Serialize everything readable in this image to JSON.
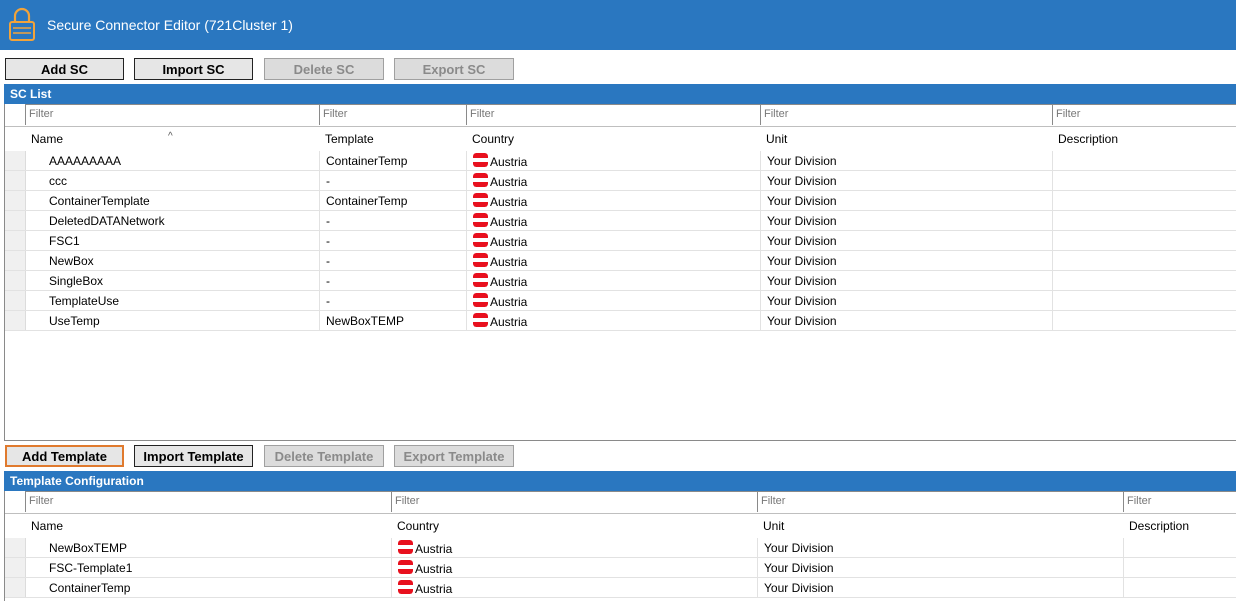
{
  "window": {
    "title": "Secure Connector Editor (721Cluster 1)"
  },
  "sc_toolbar": {
    "add": "Add SC",
    "import": "Import SC",
    "delete": "Delete SC",
    "export": "Export SC"
  },
  "sc_list": {
    "title": "SC List",
    "filter_placeholder": "Filter",
    "columns": [
      "Name",
      "Template",
      "Country",
      "Unit",
      "Description"
    ],
    "rows": [
      {
        "name": "AAAAAAAAA",
        "template": "ContainerTemp",
        "country": "Austria",
        "unit": "Your Division",
        "description": ""
      },
      {
        "name": "ccc",
        "template": "-",
        "country": "Austria",
        "unit": "Your Division",
        "description": ""
      },
      {
        "name": "ContainerTemplate",
        "template": "ContainerTemp",
        "country": "Austria",
        "unit": "Your Division",
        "description": ""
      },
      {
        "name": "DeletedDATANetwork",
        "template": "-",
        "country": "Austria",
        "unit": "Your Division",
        "description": ""
      },
      {
        "name": "FSC1",
        "template": "-",
        "country": "Austria",
        "unit": "Your Division",
        "description": ""
      },
      {
        "name": "NewBox",
        "template": "-",
        "country": "Austria",
        "unit": "Your Division",
        "description": ""
      },
      {
        "name": "SingleBox",
        "template": "-",
        "country": "Austria",
        "unit": "Your Division",
        "description": ""
      },
      {
        "name": "TemplateUse",
        "template": "-",
        "country": "Austria",
        "unit": "Your Division",
        "description": ""
      },
      {
        "name": "UseTemp",
        "template": "NewBoxTEMP",
        "country": "Austria",
        "unit": "Your Division",
        "description": ""
      }
    ]
  },
  "template_toolbar": {
    "add": "Add Template",
    "import": "Import Template",
    "delete": "Delete Template",
    "export": "Export Template"
  },
  "template_config": {
    "title": "Template Configuration",
    "filter_placeholder": "Filter",
    "columns": [
      "Name",
      "Country",
      "Unit",
      "Description"
    ],
    "rows": [
      {
        "name": "NewBoxTEMP",
        "country": "Austria",
        "unit": "Your Division",
        "description": ""
      },
      {
        "name": "FSC-Template1",
        "country": "Austria",
        "unit": "Your Division",
        "description": ""
      },
      {
        "name": "ContainerTemp",
        "country": "Austria",
        "unit": "Your Division",
        "description": ""
      }
    ]
  },
  "colors": {
    "accent": "#2a77c0",
    "focus": "#e07a2e",
    "flag_red": "#e8101e"
  }
}
